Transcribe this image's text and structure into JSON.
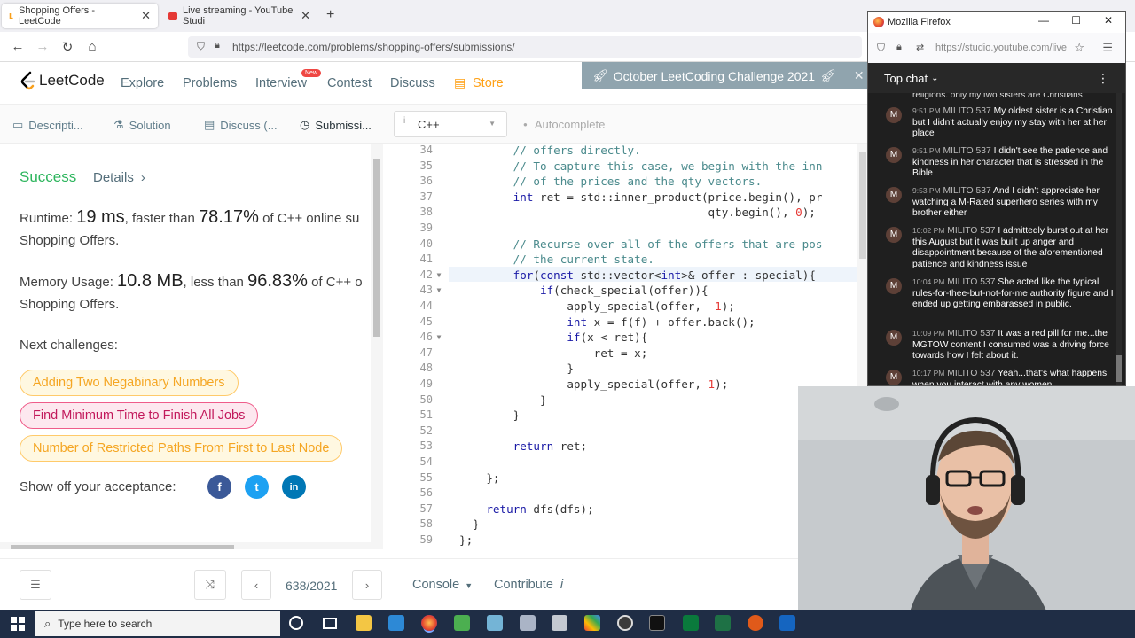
{
  "browser": {
    "tabs": [
      {
        "title": "Shopping Offers - LeetCode",
        "active": true
      },
      {
        "title": "Live streaming - YouTube Studi",
        "active": false
      }
    ],
    "url": "https://leetcode.com/problems/shopping-offers/submissions/"
  },
  "leetcode": {
    "logo": "LeetCode",
    "nav": [
      "Explore",
      "Problems",
      "Interview",
      "Contest",
      "Discuss",
      "Store"
    ],
    "new_badge": "New",
    "banner": "October LeetCoding Challenge 2021",
    "subtabs": [
      "Descripti...",
      "Solution",
      "Discuss (...",
      "Submissi..."
    ],
    "result": {
      "status": "Success",
      "details": "Details",
      "runtime_label": "Runtime:",
      "runtime_value": "19 ms",
      "runtime_mid": ", faster than",
      "runtime_pct": "78.17%",
      "runtime_tail": "of C++ online su",
      "runtime_line2": "Shopping Offers.",
      "memory_label": "Memory Usage:",
      "memory_value": "10.8 MB",
      "memory_mid": ", less than",
      "memory_pct": "96.83%",
      "memory_tail": "of C++ o",
      "memory_line2": "Shopping Offers."
    },
    "next_label": "Next challenges:",
    "challenges": [
      {
        "title": "Adding Two Negabinary Numbers",
        "difficulty": "medium"
      },
      {
        "title": "Find Minimum Time to Finish All Jobs",
        "difficulty": "hard"
      },
      {
        "title": "Number of Restricted Paths From First to Last Node",
        "difficulty": "medium"
      }
    ],
    "share_label": "Show off your acceptance:",
    "social": [
      "f",
      "t",
      "in"
    ],
    "language": "C++",
    "autocomplete": "Autocomplete",
    "pager": "638/2021",
    "console": "Console",
    "contribute": "Contribute"
  },
  "code_lines": [
    {
      "n": "34",
      "t": "        // offers directly.",
      "c": "com"
    },
    {
      "n": "35",
      "t": "        // To capture this case, we begin with the inn",
      "c": "com"
    },
    {
      "n": "36",
      "t": "        // of the prices and the qty vectors.",
      "c": "com"
    },
    {
      "n": "37",
      "t": "        int ret = std::inner_product(price.begin(), pr",
      "c": "code"
    },
    {
      "n": "38",
      "t": "                                     qty.begin(), 0);",
      "c": "code"
    },
    {
      "n": "39",
      "t": "",
      "c": "code"
    },
    {
      "n": "40",
      "t": "        // Recurse over all of the offers that are pos",
      "c": "com"
    },
    {
      "n": "41",
      "t": "        // the current state.",
      "c": "com"
    },
    {
      "n": "42",
      "t": "        for(const std::vector<int>& offer : special){",
      "c": "code",
      "fold": true
    },
    {
      "n": "43",
      "t": "            if(check_special(offer)){",
      "c": "code",
      "fold": true
    },
    {
      "n": "44",
      "t": "                apply_special(offer, -1);",
      "c": "code"
    },
    {
      "n": "45",
      "t": "                int x = f(f) + offer.back();",
      "c": "code"
    },
    {
      "n": "46",
      "t": "                if(x < ret){",
      "c": "code",
      "fold": true
    },
    {
      "n": "47",
      "t": "                    ret = x;",
      "c": "code"
    },
    {
      "n": "48",
      "t": "                }",
      "c": "code"
    },
    {
      "n": "49",
      "t": "                apply_special(offer, 1);",
      "c": "code"
    },
    {
      "n": "50",
      "t": "            }",
      "c": "code"
    },
    {
      "n": "51",
      "t": "        }",
      "c": "code"
    },
    {
      "n": "52",
      "t": "",
      "c": "code"
    },
    {
      "n": "53",
      "t": "        return ret;",
      "c": "code"
    },
    {
      "n": "54",
      "t": "",
      "c": "code"
    },
    {
      "n": "55",
      "t": "    };",
      "c": "code"
    },
    {
      "n": "56",
      "t": "",
      "c": "code"
    },
    {
      "n": "57",
      "t": "    return dfs(dfs);",
      "c": "code"
    },
    {
      "n": "58",
      "t": "  }",
      "c": "code"
    },
    {
      "n": "59",
      "t": "};",
      "c": "code"
    }
  ],
  "firefox": {
    "title": "Mozilla Firefox",
    "url": "https://studio.youtube.com/live",
    "chat_header": "Top chat",
    "partial_top": "religions. only my two sisters are Christians",
    "messages": [
      {
        "time": "9:51 PM",
        "author": "MILITO 537",
        "text": "My oldest sister is a Christian but I didn't actually enjoy my stay with her at her place"
      },
      {
        "time": "9:51 PM",
        "author": "MILITO 537",
        "text": "I didn't see the patience and kindness in her character that is stressed in the Bible"
      },
      {
        "time": "9:53 PM",
        "author": "MILITO 537",
        "text": "And I didn't appreciate her watching a M-Rated superhero series with my brother either"
      },
      {
        "time": "10:02 PM",
        "author": "MILITO 537",
        "text": "I admittedly burst out at her this August but it was built up anger and disappointment because of the aforementioned patience and kindness issue"
      },
      {
        "time": "10:04 PM",
        "author": "MILITO 537",
        "text": "She acted like the typical rules-for-thee-but-not-for-me authority figure and I ended up getting embarassed in public."
      },
      {
        "time": "10:09 PM",
        "author": "MILITO 537",
        "text": "It was a red pill for me...the MGTOW content I consumed was a driving force towards how I felt about it."
      },
      {
        "time": "10:17 PM",
        "author": "MILITO 537",
        "text": "Yeah...that's what happens when you interact with any women"
      }
    ]
  },
  "taskbar": {
    "search_placeholder": "Type here to search"
  }
}
